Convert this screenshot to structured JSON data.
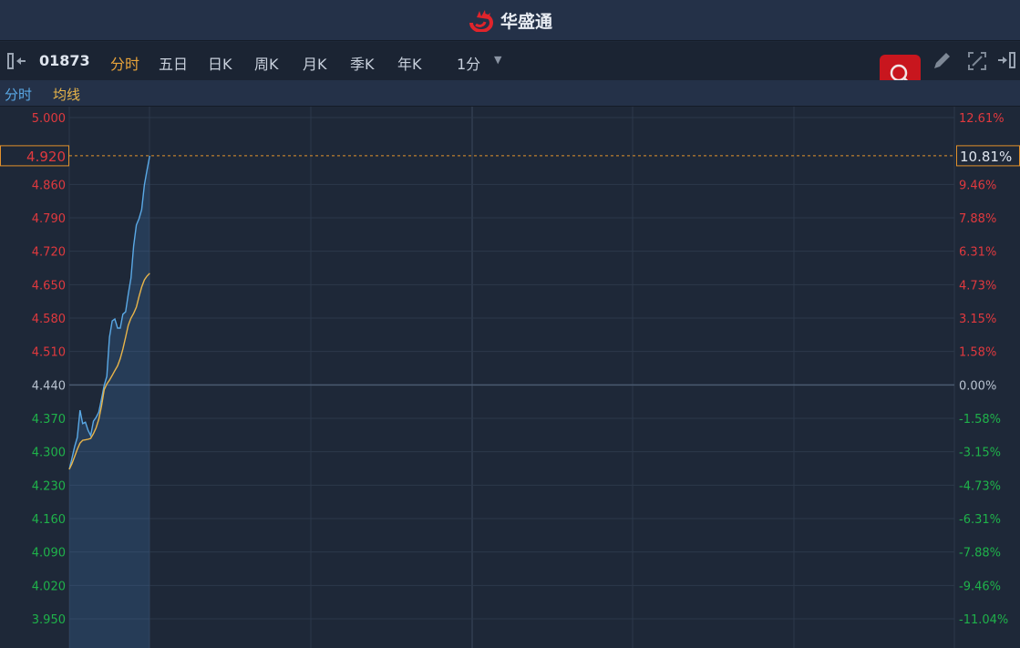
{
  "app": {
    "brand": "华盛通"
  },
  "toolbar": {
    "code": "01873",
    "periods": [
      "分时",
      "五日",
      "日K",
      "周K",
      "月K",
      "季K",
      "年K"
    ],
    "active_period": "分时",
    "interval": "1分"
  },
  "legend": {
    "line": "分时",
    "avg": "均线"
  },
  "colors": {
    "up": "#e0393e",
    "down": "#1fb24a",
    "neutral": "#b9c3d0",
    "price_line": "#5aa9e6",
    "avg_line": "#e9b54a",
    "accent": "#e2912c"
  },
  "chart_data": {
    "type": "line",
    "price_ticks": [
      "5.000",
      "4.920",
      "4.860",
      "4.790",
      "4.720",
      "4.650",
      "4.580",
      "4.510",
      "4.440",
      "4.370",
      "4.300",
      "4.230",
      "4.160",
      "4.090",
      "4.020",
      "3.950"
    ],
    "pct_ticks": [
      "12.61%",
      "10.81%",
      "9.46%",
      "7.88%",
      "6.31%",
      "4.73%",
      "3.15%",
      "1.58%",
      "0.00%",
      "-1.58%",
      "-3.15%",
      "-4.73%",
      "-6.31%",
      "-7.88%",
      "-9.46%",
      "-11.04%"
    ],
    "prev_close": 4.44,
    "ylim": [
      3.95,
      5.0
    ],
    "total_minutes": 330,
    "current_price": "4.920",
    "current_pct": "10.81%",
    "series": [
      {
        "name": "分时",
        "values": [
          4.263,
          4.286,
          4.311,
          4.33,
          4.387,
          4.359,
          4.362,
          4.345,
          4.334,
          4.364,
          4.372,
          4.383,
          4.41,
          4.439,
          4.458,
          4.54,
          4.574,
          4.578,
          4.559,
          4.559,
          4.588,
          4.593,
          4.63,
          4.664,
          4.731,
          4.775,
          4.788,
          4.807,
          4.859,
          4.89,
          4.92
        ]
      },
      {
        "name": "均线",
        "values": [
          4.263,
          4.275,
          4.29,
          4.305,
          4.318,
          4.324,
          4.325,
          4.326,
          4.328,
          4.338,
          4.35,
          4.368,
          4.395,
          4.43,
          4.442,
          4.45,
          4.46,
          4.47,
          4.48,
          4.495,
          4.515,
          4.54,
          4.565,
          4.58,
          4.59,
          4.603,
          4.625,
          4.645,
          4.66,
          4.668,
          4.674
        ]
      }
    ]
  }
}
